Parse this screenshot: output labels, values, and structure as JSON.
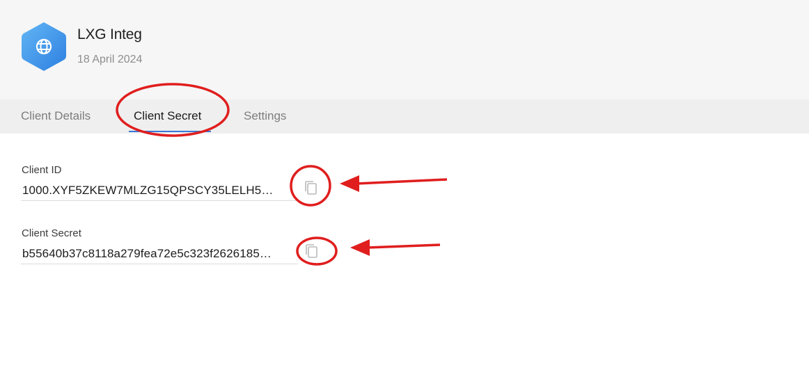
{
  "app": {
    "name": "LXG Integ",
    "date": "18 April 2024",
    "icon": "globe-icon",
    "icon_color": "#3b8fe6"
  },
  "tabs": [
    {
      "label": "Client Details",
      "active": false
    },
    {
      "label": "Client Secret",
      "active": true
    },
    {
      "label": "Settings",
      "active": false
    }
  ],
  "fields": {
    "client_id": {
      "label": "Client ID",
      "value": "1000.XYF5ZKEW7MLZG15QPSCY35LELH5…",
      "copy_icon": "copy-icon"
    },
    "client_secret": {
      "label": "Client Secret",
      "value": "b55640b37c8118a279fea72e5c323f2626185…",
      "copy_icon": "copy-icon"
    }
  },
  "annotations": {
    "color": "#e01e1e"
  },
  "colors": {
    "accent": "#3a77d6",
    "header_bg": "#f6f6f6",
    "tabs_bg": "#efefef"
  }
}
